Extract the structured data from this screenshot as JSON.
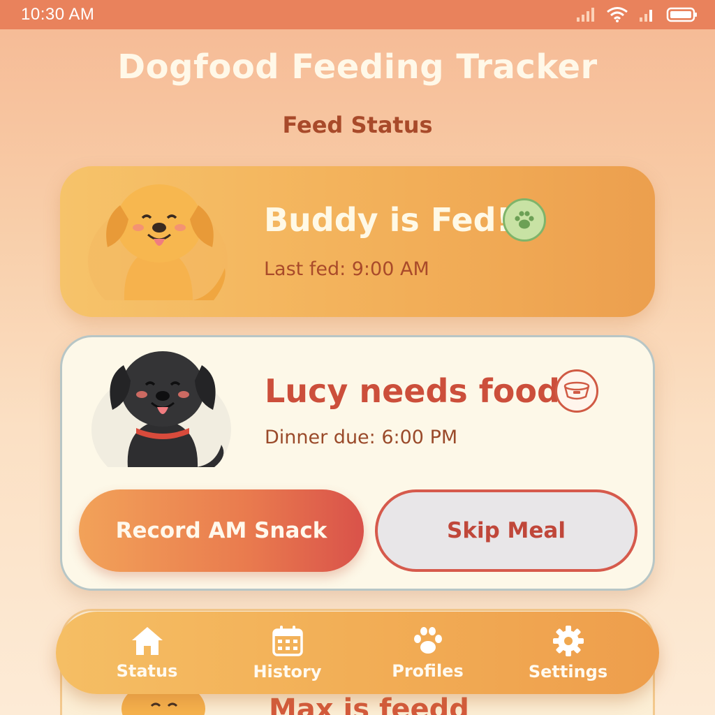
{
  "status_bar": {
    "time": "10:30 AM"
  },
  "app": {
    "title": "Dogfood Feeding Tracker",
    "section": "Feed Status"
  },
  "cards": {
    "buddy": {
      "name": "Buddy is Fed!",
      "subtitle": "Last fed: 9:00 AM",
      "badge_icon": "paw-icon"
    },
    "lucy": {
      "name": "Lucy needs food",
      "subtitle": "Dinner due: 6:00 PM",
      "badge_icon": "bowl-icon",
      "record_label": "Record AM Snack",
      "skip_label": "Skip Meal"
    },
    "max": {
      "name": "Max is feedd"
    }
  },
  "nav": {
    "items": [
      {
        "label": "Status",
        "icon": "home-icon"
      },
      {
        "label": "History",
        "icon": "calendar-icon"
      },
      {
        "label": "Profiles",
        "icon": "paw-icon"
      },
      {
        "label": "Settings",
        "icon": "gear-icon"
      }
    ]
  },
  "colors": {
    "status_bar": "#e9825c",
    "accent_orange": "#f2ae58",
    "alert_red": "#cc4f3b",
    "fed_green": "#7fb46a"
  }
}
